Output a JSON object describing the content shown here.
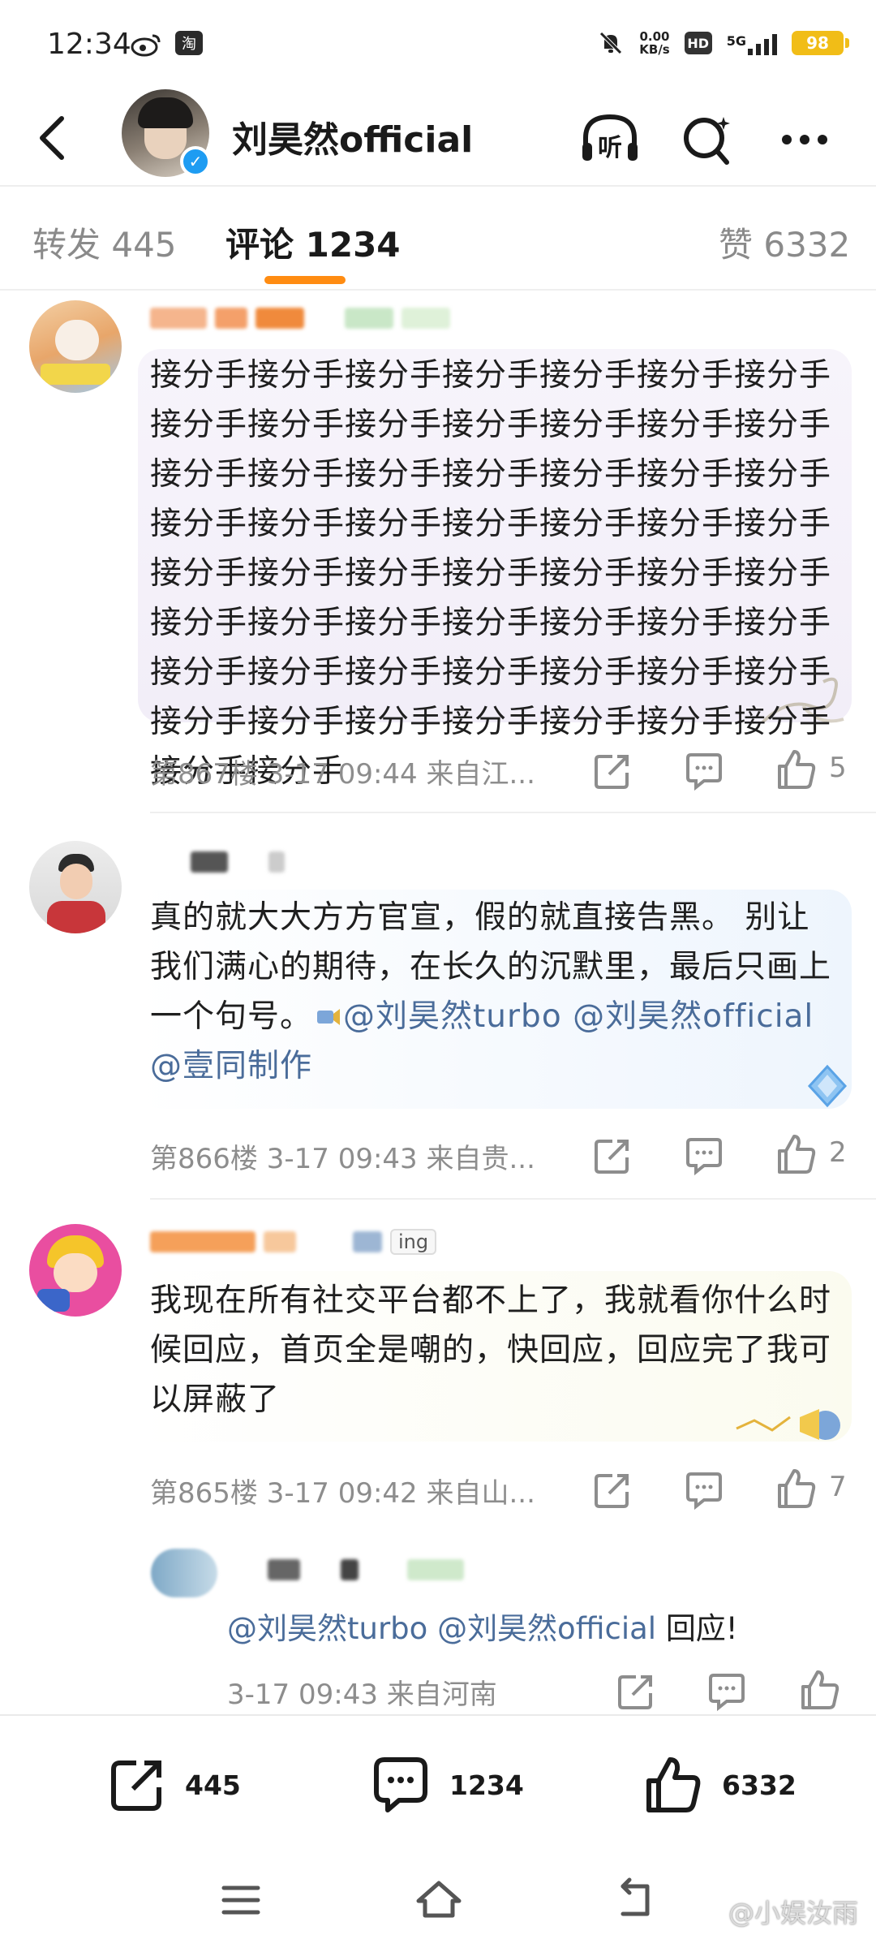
{
  "status_bar": {
    "time": "12:34",
    "left_icons": [
      "weibo-icon",
      "taobao-icon"
    ],
    "taobao_label": "淘",
    "net_speed_value": "0.00",
    "net_speed_unit": "KB/s",
    "hd_label": "HD",
    "network": "5G",
    "battery": "98"
  },
  "header": {
    "name": "刘昊然official",
    "verified_mark": "✓",
    "listen_icon": "listen-icon",
    "search_icon": "search-icon",
    "more_icon": "more-icon"
  },
  "tabs": {
    "repost": "转发 445",
    "comments": "评论 1234",
    "likes": "赞 6332"
  },
  "comments": [
    {
      "text": "接分手接分手接分手接分手接分手接分手接分手接分手接分手接分手接分手接分手接分手接分手接分手接分手接分手接分手接分手接分手接分手接分手接分手接分手接分手接分手接分手接分手接分手接分手接分手接分手接分手接分手接分手接分手接分手接分手接分手接分手接分手接分手接分手接分手接分手接分手接分手接分手接分手接分手接分手接分手接分手接分手接分手接分手接分手接分手",
      "floor": "第867楼",
      "time": "3-17 09:44",
      "location": "来自江...",
      "likes": "5"
    },
    {
      "text_prefix": "真的就大大方方官宣，假的就直接告黑。 别让我们满心的期待，在长久的沉默里，最后只画上一个句号。",
      "mention_1": "@刘昊然turbo",
      "mention_2": "@刘昊然official",
      "mention_3": "@壹同制作",
      "floor": "第866楼",
      "time": "3-17 09:43",
      "location": "来自贵...",
      "likes": "2"
    },
    {
      "name_tag": "ing",
      "text": "我现在所有社交平台都不上了，我就看你什么时候回应，首页全是嘲的，快回应，回应完了我可以屏蔽了",
      "floor": "第865楼",
      "time": "3-17 09:42",
      "location": "来自山...",
      "likes": "7"
    }
  ],
  "reply": {
    "mention_1": "@刘昊然turbo",
    "mention_2": "@刘昊然official",
    "text": "回应!",
    "time": "3-17 09:43",
    "location": "来自河南"
  },
  "bottom_bar": {
    "repost_count": "445",
    "comment_count": "1234",
    "like_count": "6332"
  },
  "watermark": "@小娱汝雨",
  "colors": {
    "accent": "#ff8c12",
    "mention": "#4a6c9a",
    "meta": "#8d8d8d",
    "verified": "#1e9cf2"
  }
}
